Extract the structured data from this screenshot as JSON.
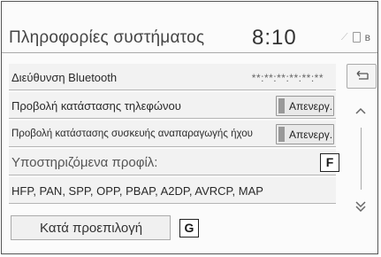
{
  "header": {
    "title": "Πληροφορίες συστήματος",
    "clock": "8:10"
  },
  "rows": [
    {
      "label": "Διεύθυνση Bluetooth",
      "value": "**:**:**:**:**:**"
    },
    {
      "label": "Προβολή κατάστασης τηλεφώνου",
      "toggle": "Απενεργ."
    },
    {
      "label": "Προβολή κατάστασης συσκευής αναπαραγωγής ήχου",
      "toggle": "Απενεργ."
    },
    {
      "label": "Υποστηριζόμενα προφίλ:"
    },
    {
      "label": "HFP, PAN, SPP, OPP, PBAP, A2DP, AVRCP, MAP"
    }
  ],
  "callouts": {
    "f": "F",
    "g": "G"
  },
  "buttons": {
    "default": "Κατά προεπιλογή"
  },
  "icons": {
    "back": "back-arrow-icon",
    "up": "chevron-up-icon",
    "down": "double-chevron-down-icon"
  }
}
